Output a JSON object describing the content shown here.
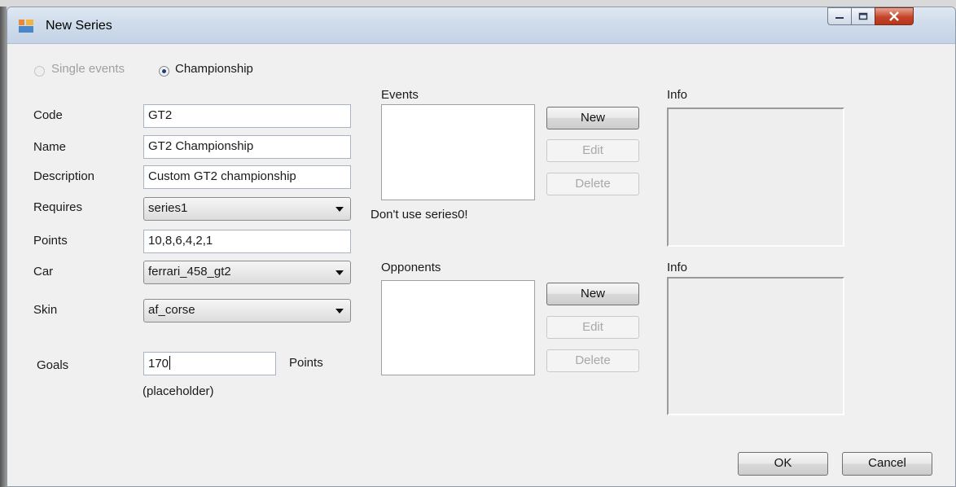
{
  "window": {
    "title": "New Series"
  },
  "mode": {
    "single_label": "Single events",
    "championship_label": "Championship",
    "selected": "Championship"
  },
  "form": {
    "code_label": "Code",
    "code_value": "GT2",
    "name_label": "Name",
    "name_value": "GT2 Championship",
    "description_label": "Description",
    "description_value": "Custom GT2 championship",
    "requires_label": "Requires",
    "requires_value": "series1",
    "points_label": "Points",
    "points_value": "10,8,6,4,2,1",
    "car_label": "Car",
    "car_value": "ferrari_458_gt2",
    "skin_label": "Skin",
    "skin_value": "af_corse",
    "goals_label": "Goals",
    "goals_value": "170",
    "goals_unit": "Points",
    "goals_note": "(placeholder)"
  },
  "events": {
    "label": "Events",
    "hint": "Don't use series0!",
    "new": "New",
    "edit": "Edit",
    "delete": "Delete"
  },
  "opponents": {
    "label": "Opponents",
    "new": "New",
    "edit": "Edit",
    "delete": "Delete"
  },
  "info": {
    "label1": "Info",
    "label2": "Info"
  },
  "footer": {
    "ok": "OK",
    "cancel": "Cancel"
  }
}
